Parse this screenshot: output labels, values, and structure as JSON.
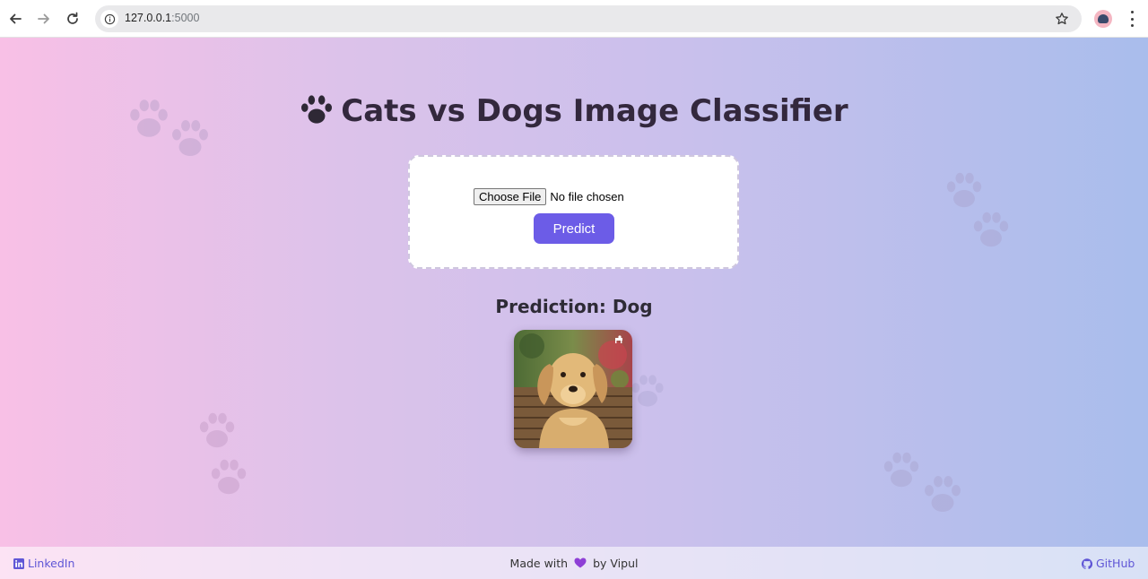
{
  "browser": {
    "url_host": "127.0.0.1",
    "url_port": ":5000"
  },
  "page": {
    "title": "Cats vs Dogs Image Classifier",
    "choose_file_label": "Choose File",
    "file_status": "No file chosen",
    "predict_label": "Predict",
    "prediction_text": "Prediction: Dog"
  },
  "footer": {
    "linkedin_label": "LinkedIn",
    "made_with_prefix": "Made with",
    "made_with_suffix": "by Vipul",
    "github_label": "GitHub"
  },
  "colors": {
    "accent": "#6c5ce7",
    "title": "#33283d"
  },
  "icons": [
    "back-icon",
    "forward-icon",
    "reload-icon",
    "site-info-icon",
    "bookmark-star-icon",
    "profile-avatar",
    "menu-kebab-icon",
    "paw-icon",
    "heart-icon",
    "linkedin-icon",
    "github-icon"
  ]
}
